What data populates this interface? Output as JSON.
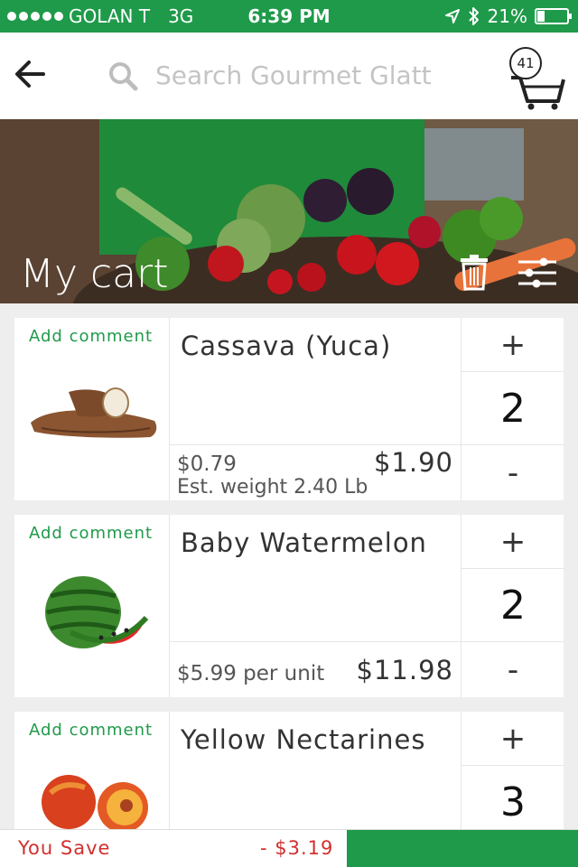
{
  "status_bar": {
    "carrier": "GOLAN T",
    "network": "3G",
    "time": "6:39 PM",
    "battery": "21%",
    "icons": [
      "location-arrow-icon",
      "bluetooth-icon",
      "battery-icon"
    ]
  },
  "header": {
    "search_placeholder": "Search Gourmet Glatt",
    "cart_count": "41"
  },
  "banner": {
    "title": "My cart"
  },
  "cart_items": [
    {
      "add_comment": "Add comment",
      "name": "Cassava (Yuca)",
      "unit_price": "$0.79",
      "est_weight": "Est. weight 2.40 Lb",
      "total": "$1.90",
      "quantity": "2",
      "plus": "+",
      "minus": "-"
    },
    {
      "add_comment": "Add comment",
      "name": "Baby Watermelon",
      "unit_price": "$5.99 per unit",
      "total": "$11.98",
      "quantity": "2",
      "plus": "+",
      "minus": "-"
    },
    {
      "add_comment": "Add comment",
      "name": "Yellow Nectarines",
      "quantity": "3",
      "plus": "+"
    }
  ],
  "footer": {
    "you_save_label": "You Save",
    "you_save_amount": "- $3.19"
  },
  "colors": {
    "brand_green": "#1f9a4a",
    "save_red": "#d32f2f"
  }
}
